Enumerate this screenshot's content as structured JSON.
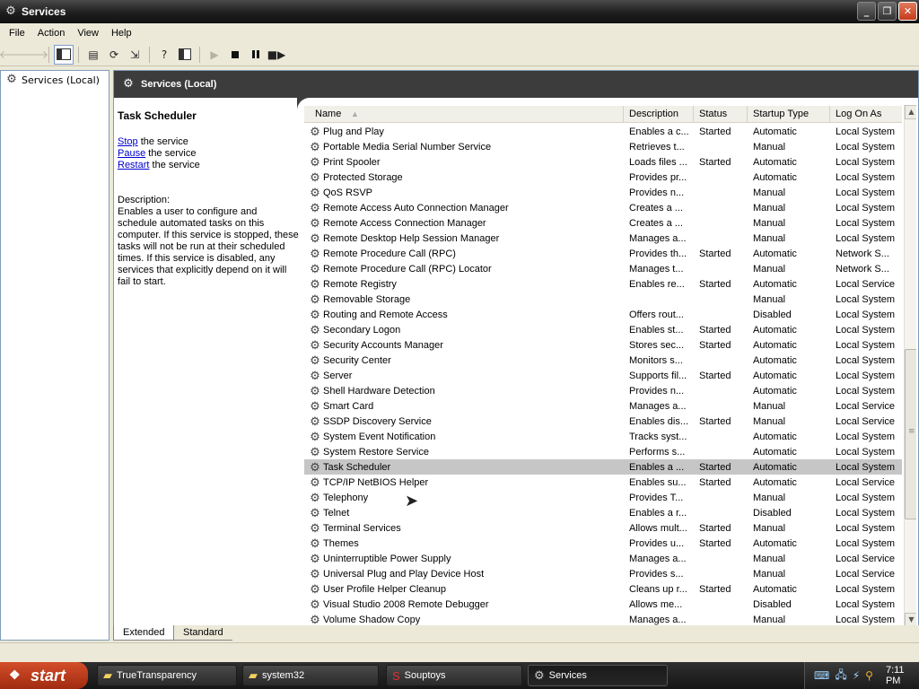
{
  "window": {
    "title": "Services"
  },
  "menu": [
    "File",
    "Action",
    "View",
    "Help"
  ],
  "tree": {
    "root_label": "Services (Local)"
  },
  "header": {
    "title": "Services (Local)"
  },
  "details": {
    "service_title": "Task Scheduler",
    "stop_link": "Stop",
    "stop_rest": " the service",
    "pause_link": "Pause",
    "pause_rest": " the service",
    "restart_link": "Restart",
    "restart_rest": " the service",
    "desc_label": "Description:",
    "desc_text": "Enables a user to configure and schedule automated tasks on this computer. If this service is stopped, these tasks will not be run at their scheduled times. If this service is disabled, any services that explicitly depend on it will fail to start."
  },
  "columns": [
    "Name",
    "Description",
    "Status",
    "Startup Type",
    "Log On As"
  ],
  "rows": [
    {
      "name": "Plug and Play",
      "desc": "Enables a c...",
      "status": "Started",
      "startup": "Automatic",
      "logon": "Local System"
    },
    {
      "name": "Portable Media Serial Number Service",
      "desc": "Retrieves t...",
      "status": "",
      "startup": "Manual",
      "logon": "Local System"
    },
    {
      "name": "Print Spooler",
      "desc": "Loads files ...",
      "status": "Started",
      "startup": "Automatic",
      "logon": "Local System"
    },
    {
      "name": "Protected Storage",
      "desc": "Provides pr...",
      "status": "",
      "startup": "Automatic",
      "logon": "Local System"
    },
    {
      "name": "QoS RSVP",
      "desc": "Provides n...",
      "status": "",
      "startup": "Manual",
      "logon": "Local System"
    },
    {
      "name": "Remote Access Auto Connection Manager",
      "desc": "Creates a ...",
      "status": "",
      "startup": "Manual",
      "logon": "Local System"
    },
    {
      "name": "Remote Access Connection Manager",
      "desc": "Creates a ...",
      "status": "",
      "startup": "Manual",
      "logon": "Local System"
    },
    {
      "name": "Remote Desktop Help Session Manager",
      "desc": "Manages a...",
      "status": "",
      "startup": "Manual",
      "logon": "Local System"
    },
    {
      "name": "Remote Procedure Call (RPC)",
      "desc": "Provides th...",
      "status": "Started",
      "startup": "Automatic",
      "logon": "Network S..."
    },
    {
      "name": "Remote Procedure Call (RPC) Locator",
      "desc": "Manages t...",
      "status": "",
      "startup": "Manual",
      "logon": "Network S..."
    },
    {
      "name": "Remote Registry",
      "desc": "Enables re...",
      "status": "Started",
      "startup": "Automatic",
      "logon": "Local Service"
    },
    {
      "name": "Removable Storage",
      "desc": "",
      "status": "",
      "startup": "Manual",
      "logon": "Local System"
    },
    {
      "name": "Routing and Remote Access",
      "desc": "Offers rout...",
      "status": "",
      "startup": "Disabled",
      "logon": "Local System"
    },
    {
      "name": "Secondary Logon",
      "desc": "Enables st...",
      "status": "Started",
      "startup": "Automatic",
      "logon": "Local System"
    },
    {
      "name": "Security Accounts Manager",
      "desc": "Stores sec...",
      "status": "Started",
      "startup": "Automatic",
      "logon": "Local System"
    },
    {
      "name": "Security Center",
      "desc": "Monitors s...",
      "status": "",
      "startup": "Automatic",
      "logon": "Local System"
    },
    {
      "name": "Server",
      "desc": "Supports fil...",
      "status": "Started",
      "startup": "Automatic",
      "logon": "Local System"
    },
    {
      "name": "Shell Hardware Detection",
      "desc": "Provides n...",
      "status": "",
      "startup": "Automatic",
      "logon": "Local System"
    },
    {
      "name": "Smart Card",
      "desc": "Manages a...",
      "status": "",
      "startup": "Manual",
      "logon": "Local Service"
    },
    {
      "name": "SSDP Discovery Service",
      "desc": "Enables dis...",
      "status": "Started",
      "startup": "Manual",
      "logon": "Local Service"
    },
    {
      "name": "System Event Notification",
      "desc": "Tracks syst...",
      "status": "",
      "startup": "Automatic",
      "logon": "Local System"
    },
    {
      "name": "System Restore Service",
      "desc": "Performs s...",
      "status": "",
      "startup": "Automatic",
      "logon": "Local System"
    },
    {
      "name": "Task Scheduler",
      "desc": "Enables a ...",
      "status": "Started",
      "startup": "Automatic",
      "logon": "Local System",
      "selected": true
    },
    {
      "name": "TCP/IP NetBIOS Helper",
      "desc": "Enables su...",
      "status": "Started",
      "startup": "Automatic",
      "logon": "Local Service"
    },
    {
      "name": "Telephony",
      "desc": "Provides T...",
      "status": "",
      "startup": "Manual",
      "logon": "Local System"
    },
    {
      "name": "Telnet",
      "desc": "Enables a r...",
      "status": "",
      "startup": "Disabled",
      "logon": "Local System"
    },
    {
      "name": "Terminal Services",
      "desc": "Allows mult...",
      "status": "Started",
      "startup": "Manual",
      "logon": "Local System"
    },
    {
      "name": "Themes",
      "desc": "Provides u...",
      "status": "Started",
      "startup": "Automatic",
      "logon": "Local System"
    },
    {
      "name": "Uninterruptible Power Supply",
      "desc": "Manages a...",
      "status": "",
      "startup": "Manual",
      "logon": "Local Service"
    },
    {
      "name": "Universal Plug and Play Device Host",
      "desc": "Provides s...",
      "status": "",
      "startup": "Manual",
      "logon": "Local Service"
    },
    {
      "name": "User Profile Helper Cleanup",
      "desc": "Cleans up r...",
      "status": "Started",
      "startup": "Automatic",
      "logon": "Local System"
    },
    {
      "name": "Visual Studio 2008 Remote Debugger",
      "desc": "Allows me...",
      "status": "",
      "startup": "Disabled",
      "logon": "Local System"
    },
    {
      "name": "Volume Shadow Copy",
      "desc": "Manages a...",
      "status": "",
      "startup": "Manual",
      "logon": "Local System"
    }
  ],
  "tabs": {
    "extended": "Extended",
    "standard": "Standard"
  },
  "taskbar": {
    "start_label": "start",
    "tasks": [
      "TrueTransparency",
      "system32",
      "Souptoys",
      "Services"
    ],
    "clock": "7:11 PM"
  },
  "icons": {
    "service": "gear-icon",
    "folder": "folder-icon",
    "back": "back-arrow-icon",
    "forward": "forward-arrow-icon"
  },
  "colors": {
    "titlebar": "#1e1e1e",
    "header": "#3c3c3c",
    "selected_row": "#c6c6c6",
    "link": "#0000cc",
    "start": "#c43b1a"
  }
}
